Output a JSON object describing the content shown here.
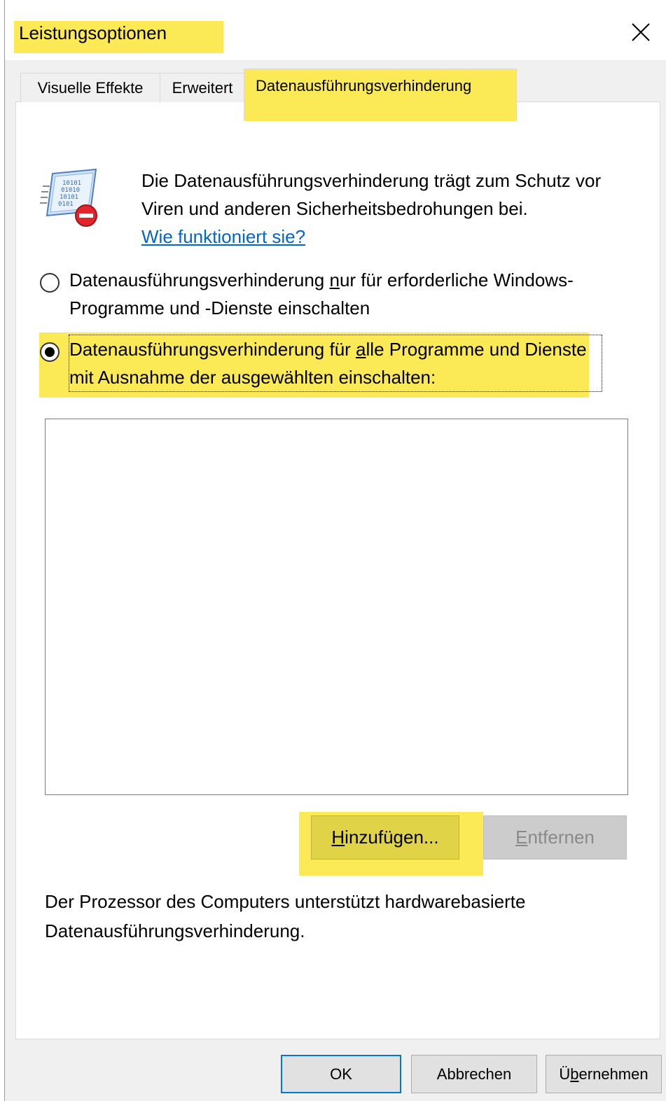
{
  "window": {
    "title": "Leistungsoptionen"
  },
  "tabs": [
    {
      "label": "Visuelle Effekte",
      "selected": false
    },
    {
      "label": "Erweitert",
      "selected": false
    },
    {
      "label": "Datenausführungsverhinderung",
      "selected": true
    }
  ],
  "description": {
    "text": "Die Datenausführungsverhinderung trägt zum Schutz vor Viren und anderen Sicherheitsbedrohungen bei.",
    "link": "Wie funktioniert sie?"
  },
  "options": {
    "radio1": {
      "pre": "Datenausführungsverhinderung ",
      "accel": "n",
      "post": "ur für erforderliche Windows-Programme und -Dienste einschalten",
      "checked": false
    },
    "radio2": {
      "pre": "Datenausführungsverhinderung für ",
      "accel": "a",
      "post": "lle Programme und Dienste mit Ausnahme der ausgewählten einschalten:",
      "checked": true
    }
  },
  "exceptions_list": [],
  "buttons": {
    "add": {
      "accel": "H",
      "rest": "inzufügen..."
    },
    "remove": {
      "accel": "E",
      "rest": "ntfernen",
      "disabled": true
    },
    "ok": "OK",
    "cancel": "Abbrechen",
    "apply": {
      "pre": "Ü",
      "accel": "b",
      "rest": "ernehmen"
    }
  },
  "info_text": "Der Prozessor des Computers unterstützt hardwarebasierte Datenausführungsverhinderung.",
  "colors": {
    "highlight": "#fbe955",
    "link": "#0066cc",
    "focus_border": "#0078d7"
  },
  "icons": {
    "close": "close-icon",
    "dep": "dep-shield-icon"
  }
}
